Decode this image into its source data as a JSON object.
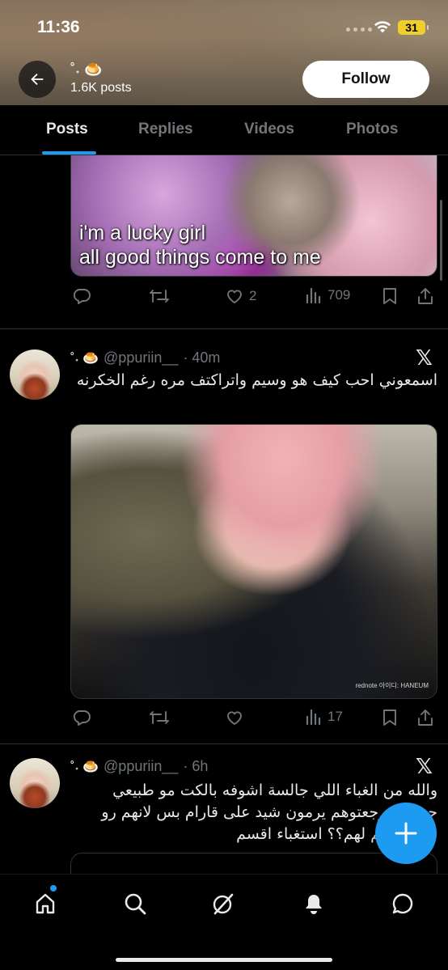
{
  "status_bar": {
    "time": "11:36",
    "battery": "31"
  },
  "profile": {
    "name": "˚˖ 🍮",
    "posts": "1.6K posts",
    "follow_label": "Follow"
  },
  "tabs": [
    {
      "label": "Posts",
      "active": true
    },
    {
      "label": "Replies",
      "active": false
    },
    {
      "label": "Videos",
      "active": false
    },
    {
      "label": "Photos",
      "active": false
    }
  ],
  "posts": [
    {
      "media_caption": [
        "i'm a lucky girl",
        "all good things come to me"
      ],
      "likes": "2",
      "views": "709"
    },
    {
      "display_name": "˚˖ 🍮",
      "handle": "@ppuriin__",
      "time": "· 40m",
      "text": "اسمعوني احب كيف هو وسيم واتراكتف مره رغم الخكرنه",
      "media_watermark": "rednote 아이디: HANEUM",
      "likes": "",
      "views": "17"
    },
    {
      "display_name": "˚˖ 🍮",
      "handle": "@ppuriin__",
      "time": "· 6h",
      "text": "والله من الغباء اللي جالسة اشوفه بالكت مو طبيعي حساس رجعتوهم يرمون شيد على قارام بس لانهم رو فيديو قديم لهم؟؟ استغباء اقسم"
    }
  ],
  "colors": {
    "accent": "#1d9bf0",
    "background": "#000000",
    "muted": "#71767b"
  },
  "icons": {
    "header": [
      "back-arrow-icon",
      "wifi-icon"
    ],
    "actions": [
      "reply-icon",
      "retweet-icon",
      "like-icon",
      "views-icon",
      "bookmark-icon",
      "share-icon"
    ],
    "nav": [
      "home-icon",
      "search-icon",
      "grok-icon",
      "notifications-icon",
      "messages-icon"
    ],
    "fab": "compose-plus-icon"
  }
}
